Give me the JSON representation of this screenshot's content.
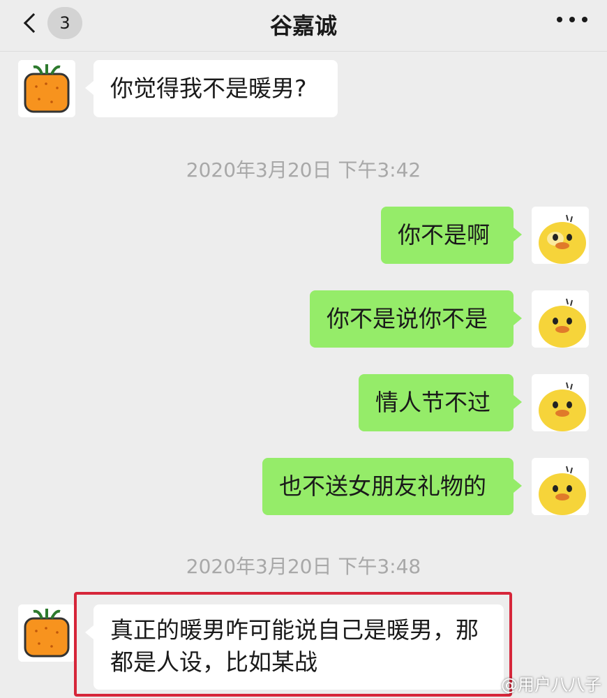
{
  "header": {
    "back_icon": "chevron-left-icon",
    "unread_count": "3",
    "title": "谷嘉诚",
    "more_icon": "more-dots-icon"
  },
  "messages": [
    {
      "side": "left",
      "text": "你觉得我不是暖男?",
      "avatar": "orange-avatar"
    },
    {
      "type": "timestamp",
      "text": "2020年3月20日 下午3:42"
    },
    {
      "side": "right",
      "text": "你不是啊",
      "avatar": "chick-avatar"
    },
    {
      "side": "right",
      "text": "你不是说你不是",
      "avatar": "chick-avatar"
    },
    {
      "side": "right",
      "text": "情人节不过",
      "avatar": "chick-avatar"
    },
    {
      "side": "right",
      "text": "也不送女朋友礼物的",
      "avatar": "chick-avatar"
    },
    {
      "type": "timestamp",
      "text": "2020年3月20日 下午3:48"
    },
    {
      "side": "left",
      "text_line1": "真正的暖男咋可能说自己是暖男，那",
      "text_line2": "都是人设，比如某战",
      "avatar": "orange-avatar",
      "highlighted": true
    }
  ],
  "watermark": "@用户八八子",
  "colors": {
    "background": "#ededed",
    "bubble_self": "#95ec69",
    "bubble_other": "#ffffff",
    "highlight": "#d6263a"
  }
}
